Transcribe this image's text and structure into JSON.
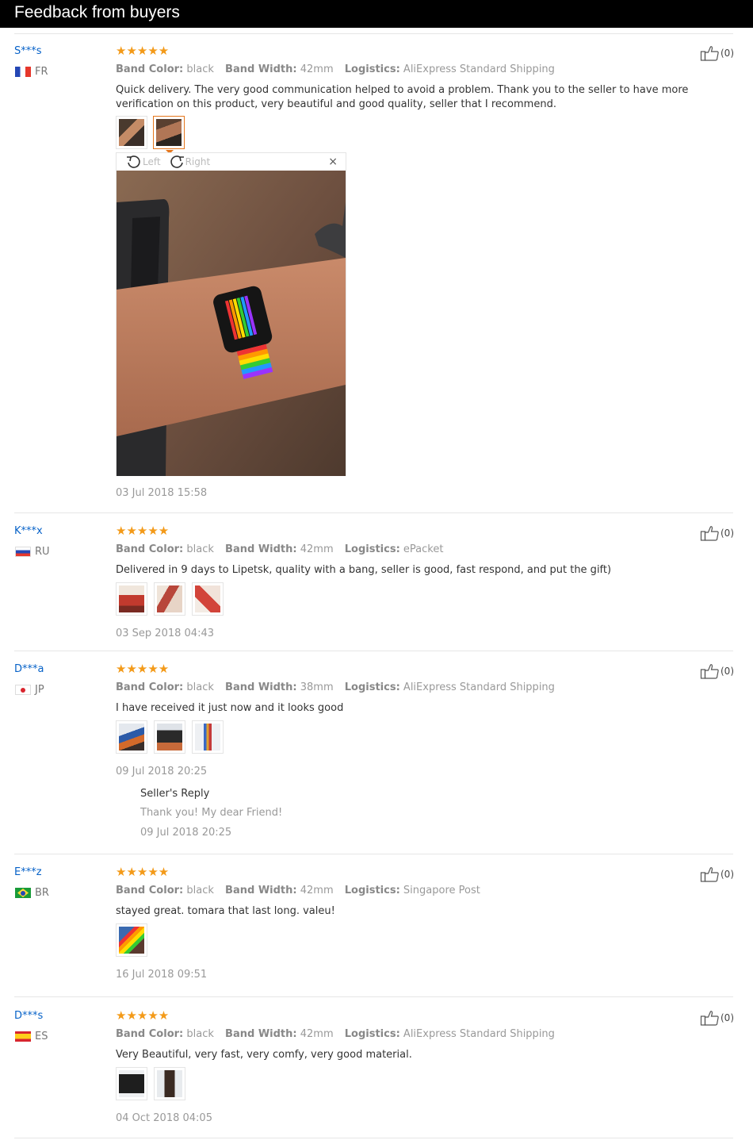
{
  "header": {
    "title": "Feedback from buyers"
  },
  "labels": {
    "band_color": "Band Color:",
    "band_width": "Band Width:",
    "logistics": "Logistics:",
    "rotate_left": "Left",
    "rotate_right": "Right",
    "close": "×",
    "stars": "★★★★★"
  },
  "colors": {
    "accent": "#e5761c",
    "star": "#f39a19",
    "link": "#0762c8",
    "header_bg": "#000000"
  },
  "reviews": [
    {
      "user": "S***s",
      "country": "FR",
      "flag": "fr",
      "rating": 5,
      "band_color": "black",
      "band_width": "42mm",
      "logistics": "AliExpress Standard Shipping",
      "text": "Quick delivery. The very good communication helped to avoid a problem. Thank you to the seller to have more verification on this product, very beautiful and good quality, seller that I recommend.",
      "likes": "(0)",
      "images": 2,
      "date": "03 Jul 2018 15:58"
    },
    {
      "user": "K***x",
      "country": "RU",
      "flag": "ru",
      "rating": 5,
      "band_color": "black",
      "band_width": "42mm",
      "logistics": "ePacket",
      "text": "Delivered in 9 days to Lipetsk, quality with a bang, seller is good, fast respond, and put the gift)",
      "likes": "(0)",
      "images": 3,
      "date": "03 Sep 2018 04:43"
    },
    {
      "user": "D***a",
      "country": "JP",
      "flag": "jp",
      "rating": 5,
      "band_color": "black",
      "band_width": "38mm",
      "logistics": "AliExpress Standard Shipping",
      "text": "I have received it just now and it looks good",
      "likes": "(0)",
      "images": 3,
      "date": "09 Jul 2018 20:25",
      "reply": {
        "title": "Seller's Reply",
        "text": "Thank you! My dear Friend!",
        "date": "09 Jul 2018 20:25"
      }
    },
    {
      "user": "E***z",
      "country": "BR",
      "flag": "br",
      "rating": 5,
      "band_color": "black",
      "band_width": "42mm",
      "logistics": "Singapore Post",
      "text": "stayed great. tomara that last long. valeu!",
      "likes": "(0)",
      "images": 1,
      "date": "16 Jul 2018 09:51"
    },
    {
      "user": "D***s",
      "country": "ES",
      "flag": "es",
      "rating": 5,
      "band_color": "black",
      "band_width": "42mm",
      "logistics": "AliExpress Standard Shipping",
      "text": "Very Beautiful, very fast, very comfy, very good material.",
      "likes": "(0)",
      "images": 2,
      "date": "04 Oct 2018 04:05"
    }
  ]
}
